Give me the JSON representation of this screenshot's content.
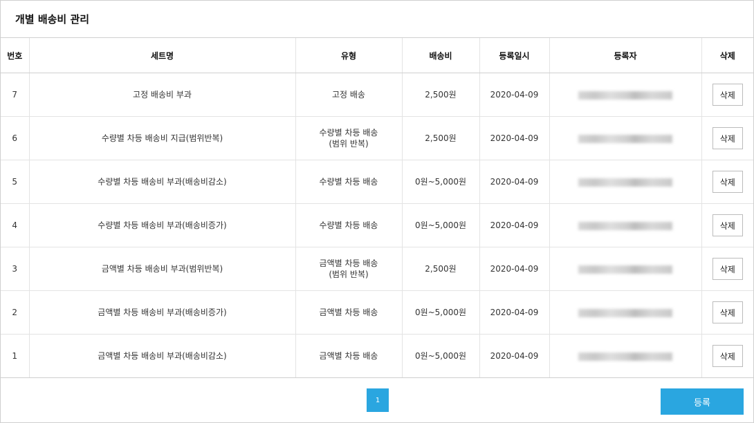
{
  "title": "개별 배송비 관리",
  "columns": {
    "no": "번호",
    "set_name": "세트명",
    "type": "유형",
    "fee": "배송비",
    "date": "등록일시",
    "registrant": "등록자",
    "delete": "삭제"
  },
  "rows": [
    {
      "no": "7",
      "set_name": "고정 배송비 부과",
      "type_line1": "고정 배송",
      "type_line2": "",
      "fee": "2,500원",
      "date": "2020-04-09",
      "delete_label": "삭제"
    },
    {
      "no": "6",
      "set_name": "수량별 차등 배송비 지급(범위반복)",
      "type_line1": "수량별 차등 배송",
      "type_line2": "(범위 반복)",
      "fee": "2,500원",
      "date": "2020-04-09",
      "delete_label": "삭제"
    },
    {
      "no": "5",
      "set_name": "수량별 차등 배송비 부과(배송비감소)",
      "type_line1": "수량별 차등 배송",
      "type_line2": "",
      "fee": "0원~5,000원",
      "date": "2020-04-09",
      "delete_label": "삭제"
    },
    {
      "no": "4",
      "set_name": "수량별 차등 배송비 부과(배송비증가)",
      "type_line1": "수량별 차등 배송",
      "type_line2": "",
      "fee": "0원~5,000원",
      "date": "2020-04-09",
      "delete_label": "삭제"
    },
    {
      "no": "3",
      "set_name": "금액별 차등 배송비 부과(범위반복)",
      "type_line1": "금액별 차등 배송",
      "type_line2": "(범위 반복)",
      "fee": "2,500원",
      "date": "2020-04-09",
      "delete_label": "삭제"
    },
    {
      "no": "2",
      "set_name": "금액별 차등 배송비 부과(배송비증가)",
      "type_line1": "금액별 차등 배송",
      "type_line2": "",
      "fee": "0원~5,000원",
      "date": "2020-04-09",
      "delete_label": "삭제"
    },
    {
      "no": "1",
      "set_name": "금액별 차등 배송비 부과(배송비감소)",
      "type_line1": "금액별 차등 배송",
      "type_line2": "",
      "fee": "0원~5,000원",
      "date": "2020-04-09",
      "delete_label": "삭제"
    }
  ],
  "pagination": {
    "current": "1"
  },
  "register_label": "등록",
  "colors": {
    "accent": "#2aa6e0",
    "border": "#cfcfcf"
  }
}
